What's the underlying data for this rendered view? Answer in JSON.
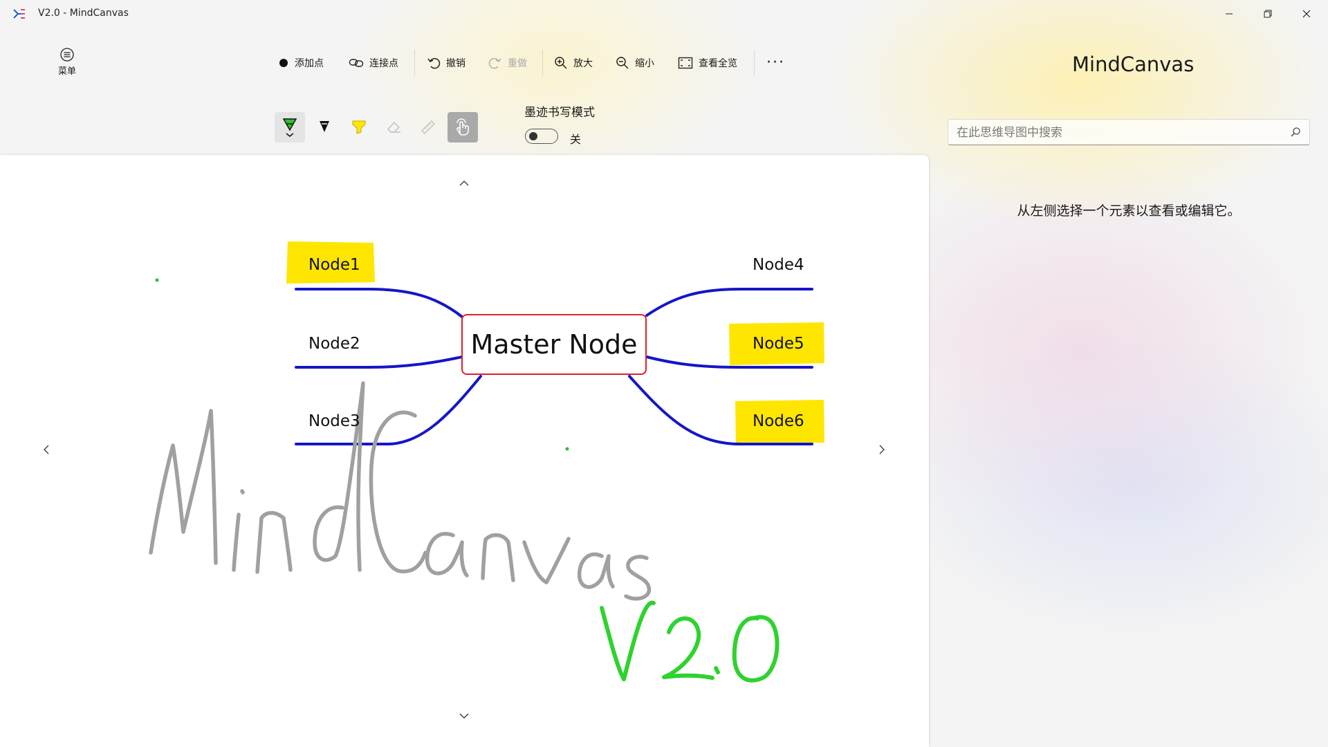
{
  "window": {
    "title": "V2.0 - MindCanvas"
  },
  "menu": {
    "label": "菜单"
  },
  "commands": {
    "add_point": "添加点",
    "connect_point": "连接点",
    "undo": "撤销",
    "redo": "重做",
    "zoom_in": "放大",
    "zoom_out": "缩小",
    "fit_view": "查看全览",
    "more": "···"
  },
  "ink": {
    "mode_label": "墨迹书写模式",
    "toggle_state": "关",
    "tools": [
      "ballpoint-pen",
      "pencil",
      "highlighter",
      "eraser",
      "ruler",
      "touch-writing"
    ],
    "pen_color": "#2fbf2f",
    "highlight_color": "#ffe600"
  },
  "mindmap": {
    "master": "Master Node",
    "nodes": {
      "node1": "Node1",
      "node2": "Node2",
      "node3": "Node3",
      "node4": "Node4",
      "node5": "Node5",
      "node6": "Node6"
    },
    "highlighted": [
      "Node1",
      "Node5",
      "Node6"
    ],
    "branch_color": "#1515c8",
    "master_border_color": "#e01e2b"
  },
  "handwriting": {
    "text1": "MindCanvas",
    "text1_color": "#a0a0a0",
    "text2": "V2.0",
    "text2_color": "#2fd22f"
  },
  "sidebar": {
    "app_name": "MindCanvas",
    "search_placeholder": "在此思维导图中搜索",
    "hint": "从左侧选择一个元素以查看或编辑它。"
  }
}
